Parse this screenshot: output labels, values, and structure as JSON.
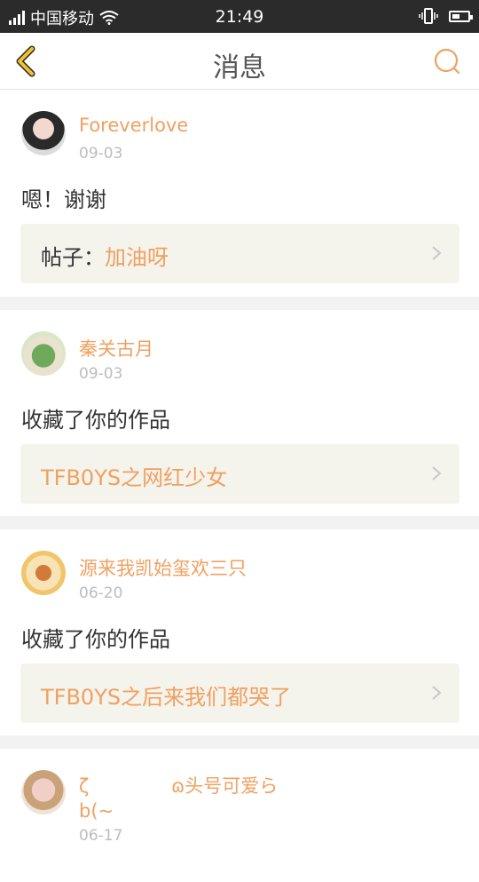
{
  "status_bar": {
    "carrier": "中国移动",
    "time": "21:49"
  },
  "nav": {
    "title": "消息"
  },
  "messages": [
    {
      "username": "Foreverlove",
      "date": "09-03",
      "text": "嗯！谢谢",
      "ref_prefix": "帖子：",
      "ref_title": "加油呀"
    },
    {
      "username": "秦关古月",
      "date": "09-03",
      "text": "收藏了你的作品",
      "ref_prefix": "",
      "ref_title": "TFB0YS之网红少女"
    },
    {
      "username": "源来我凯始玺欢三只",
      "date": "06-20",
      "text": "收藏了你的作品",
      "ref_prefix": "",
      "ref_title": "TFB0YS之后来我们都哭了"
    },
    {
      "username_line1": "ζ",
      "username_line1b": "ɷ头号可爱ら",
      "username_line2": "b(~",
      "date": "06-17"
    }
  ],
  "colors": {
    "accent": "#f0a060",
    "status_bar_bg": "#2b2b2b",
    "ref_box_bg": "#f4f3ec",
    "back_arrow": "#f2c12e"
  }
}
